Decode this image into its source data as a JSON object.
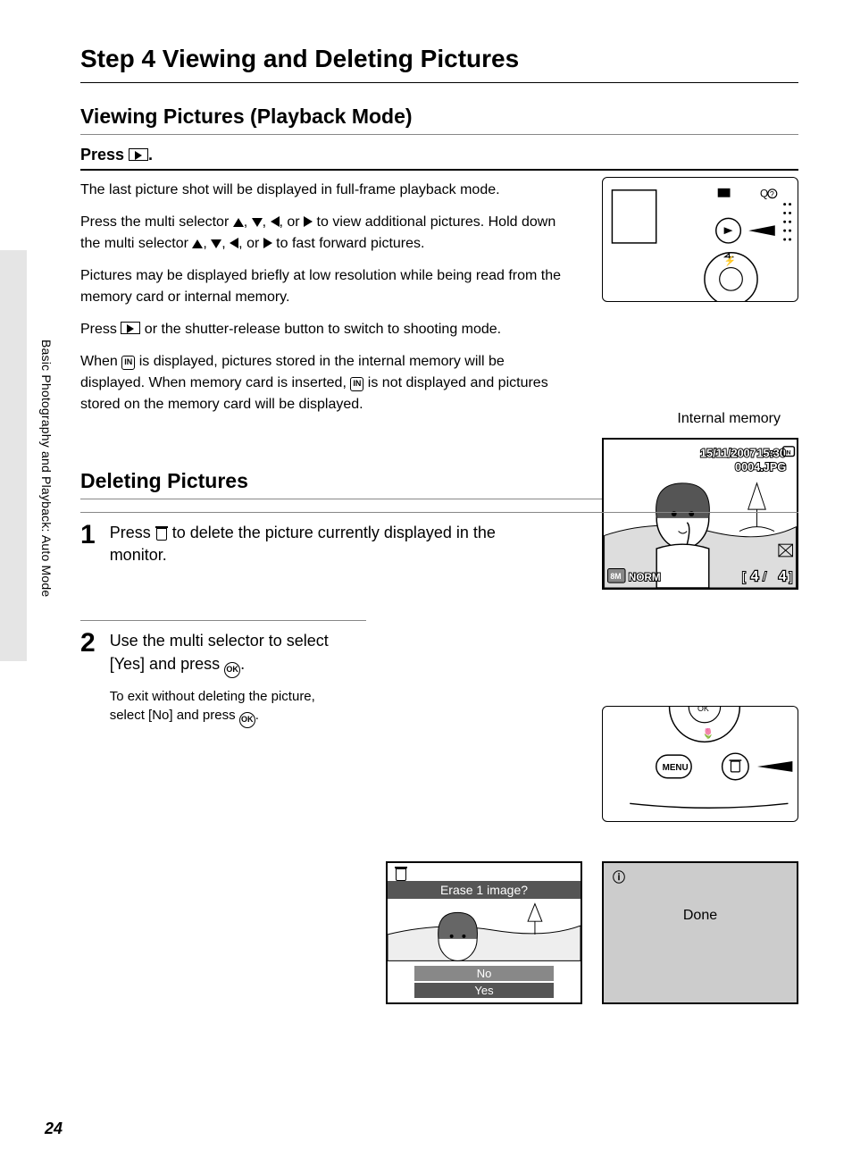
{
  "page_number": "24",
  "side_label": "Basic Photography and Playback: Auto Mode",
  "title": "Step 4 Viewing and Deleting Pictures",
  "section_viewing": {
    "heading": "Viewing Pictures (Playback Mode)",
    "press_label": "Press ",
    "press_suffix": ".",
    "p1": "The last picture shot will be displayed in full-frame playback mode.",
    "p2a": "Press the multi selector ",
    "p2b": " to view additional pictures. Hold down the multi selector ",
    "p2c": " to fast forward pictures.",
    "sep": ", ",
    "or": ", or ",
    "p3": "Pictures may be displayed briefly at low resolution while being read from the memory card or internal memory.",
    "p4a": "Press ",
    "p4b": " or the shutter-release button to switch to shooting mode.",
    "p5a": "When ",
    "p5b": " is displayed, pictures stored in the internal memory will be displayed. When memory card is inserted, ",
    "p5c": " is not displayed and pictures stored on the memory card will be displayed.",
    "in_label": "IN",
    "internal_memory_label": "Internal memory",
    "thumb": {
      "date": "15/11/2007",
      "time": "15:30",
      "filename": "0004.JPG",
      "quality": "NORM",
      "size_badge": "8M",
      "index_current": "4",
      "index_total": "4"
    }
  },
  "section_deleting": {
    "heading": "Deleting Pictures",
    "step1_num": "1",
    "step1a": "Press ",
    "step1b": " to delete the picture currently displayed in the monitor.",
    "step2_num": "2",
    "step2a": "Use the multi selector to select [Yes] and press ",
    "step2b": ".",
    "step2_note_a": "To exit without deleting the picture, select [No] and press ",
    "step2_note_b": ".",
    "ok_label": "OK",
    "menu_label": "MENU",
    "erase_prompt": "Erase 1 image?",
    "opt_no": "No",
    "opt_yes": "Yes",
    "done_label": "Done",
    "info_glyph": "ⓘ"
  }
}
